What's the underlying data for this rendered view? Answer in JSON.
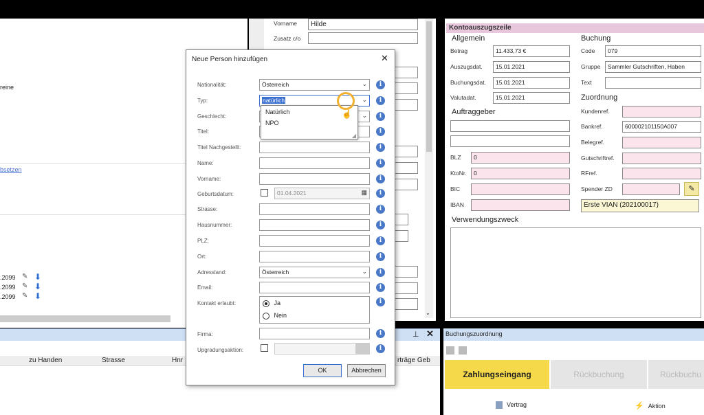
{
  "left_panel": {
    "fragment_reine": "reine",
    "fragment_link": "bsetzen",
    "dates": [
      ".2099",
      ".2099",
      ".2099"
    ],
    "columns": [
      "zu Handen",
      "Strasse",
      "Hnr"
    ]
  },
  "middle_panel": {
    "vorname_label": "Vorname",
    "vorname_value": "Hilde",
    "zusatz_label": "Zusatz c/o",
    "vertraege_col": "rträge Geb"
  },
  "konto": {
    "header": "Kontoauszugszeile",
    "allgemein_title": "Allgemein",
    "betrag_label": "Betrag",
    "betrag_value": "11.433,73 €",
    "auszugsdat_label": "Auszugsdat.",
    "auszugsdat_value": "15.01.2021",
    "buchungsdat_label": "Buchungsdat.",
    "buchungsdat_value": "15.01.2021",
    "valutadat_label": "Valutadat.",
    "valutadat_value": "15.01.2021",
    "buchung_title": "Buchung",
    "code_label": "Code",
    "code_value": "079",
    "gruppe_label": "Gruppe",
    "gruppe_value": "Sammler Gutschriften, Haben",
    "text_label": "Text",
    "auftraggeber_title": "Auftraggeber",
    "blz_label": "BLZ",
    "blz_value": "0",
    "ktonr_label": "KtoNr.",
    "ktonr_value": "0",
    "bic_label": "BIC",
    "iban_label": "IBAN",
    "zuordnung_title": "Zuordnung",
    "kundenref_label": "Kundenref.",
    "bankref_label": "Bankref.",
    "bankref_value": "600002101150A007",
    "belegref_label": "Belegref.",
    "gutschriftref_label": "Gutschriftref.",
    "rfref_label": "RFref.",
    "spender_label": "Spender ZD",
    "spender_value": "Erste VIAN (202100017)",
    "verwendung_title": "Verwendungszweck"
  },
  "buchungszuordnung": {
    "title": "Buchungszuordnung",
    "tab_active": "Zahlungseingang",
    "tab2": "Rückbuchung",
    "tab3": "Rückbuchu",
    "vertrag_label": "Vertrag",
    "aktion_label": "Aktion"
  },
  "dialog": {
    "title": "Neue Person hinzufügen",
    "nationalitaet_label": "Nationalität:",
    "nationalitaet_value": "Österreich",
    "typ_label": "Typ:",
    "typ_value": "natürlich",
    "typ_options": [
      "Natürlich",
      "NPO"
    ],
    "geschlecht_label": "Geschlecht:",
    "titel_label": "Titel:",
    "titel_nach_label": "Titel Nachgestellt:",
    "name_label": "Name:",
    "vorname_label": "Vorname:",
    "geburtsdatum_label": "Geburtsdatum:",
    "geburtsdatum_value": "01.04.2021",
    "strasse_label": "Strasse:",
    "hausnummer_label": "Hausnummer:",
    "plz_label": "PLZ:",
    "ort_label": "Ort:",
    "adressland_label": "Adressland:",
    "adressland_value": "Österreich",
    "email_label": "Email:",
    "kontakt_label": "Kontakt erlaubt:",
    "ja_label": "Ja",
    "nein_label": "Nein",
    "firma_label": "Firma:",
    "upgrade_label": "Upgradungsaktion:",
    "ok_label": "OK",
    "cancel_label": "Abbrechen"
  },
  "colors": {
    "accent_yellow": "#f5d94a",
    "pink": "#fbe4ec",
    "header_pink": "#e8c6dc",
    "blue_bar": "#cfe0f4"
  }
}
